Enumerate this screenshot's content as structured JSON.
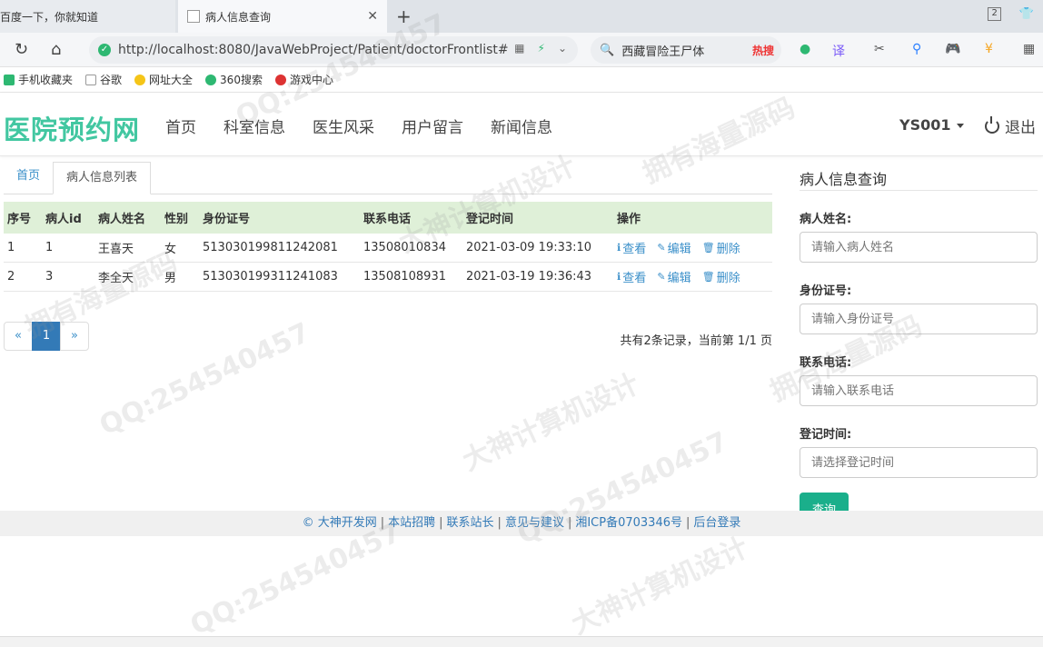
{
  "browser": {
    "tabs": [
      {
        "label": "百度一下，你就知道"
      },
      {
        "label": "病人信息查询"
      }
    ],
    "tab_count": "2",
    "url": "http://localhost:8080/JavaWebProject/Patient/doctorFrontlist#",
    "search_text": "西藏冒险王尸体",
    "search_hot": "热搜",
    "bookmarks": [
      "手机收藏夹",
      "谷歌",
      "网址大全",
      "360搜索",
      "游戏中心"
    ]
  },
  "site": {
    "brand": "医院预约网",
    "menu": [
      "首页",
      "科室信息",
      "医生风采",
      "用户留言",
      "新闻信息"
    ],
    "user": "YS001",
    "logout": "退出"
  },
  "breadcrumb": {
    "home": "首页",
    "current": "病人信息列表"
  },
  "table": {
    "headers": [
      "序号",
      "病人id",
      "病人姓名",
      "性别",
      "身份证号",
      "联系电话",
      "登记时间",
      "操作"
    ],
    "rows": [
      [
        "1",
        "1",
        "王喜天",
        "女",
        "513030199811242081",
        "13508010834",
        "2021-03-09 19:33:10"
      ],
      [
        "2",
        "3",
        "李全天",
        "男",
        "513030199311241083",
        "13508108931",
        "2021-03-19 19:36:43"
      ]
    ],
    "actions": {
      "view": "查看",
      "edit": "编辑",
      "delete": "删除"
    }
  },
  "pager": {
    "prev": "«",
    "current": "1",
    "next": "»",
    "info": "共有2条记录，当前第 1/1 页"
  },
  "search_form": {
    "title": "病人信息查询",
    "name_label": "病人姓名:",
    "name_placeholder": "请输入病人姓名",
    "card_label": "身份证号:",
    "card_placeholder": "请输入身份证号",
    "phone_label": "联系电话:",
    "phone_placeholder": "请输入联系电话",
    "time_label": "登记时间:",
    "time_placeholder": "请选择登记时间",
    "submit": "查询"
  },
  "footer": {
    "links": [
      "© 大神开发网",
      "本站招聘",
      "联系站长",
      "意见与建议",
      "湘ICP备0703346号",
      "后台登录"
    ]
  },
  "watermark": {
    "qq": "QQ:254540457",
    "a": "大神计算机设计",
    "b": "拥有海量源码"
  },
  "colors": {
    "brand": "#42c7a1",
    "link": "#3a8fc9",
    "table_header": "#dff0d8",
    "primary": "#337ab7",
    "submit": "#1aaf8b"
  }
}
